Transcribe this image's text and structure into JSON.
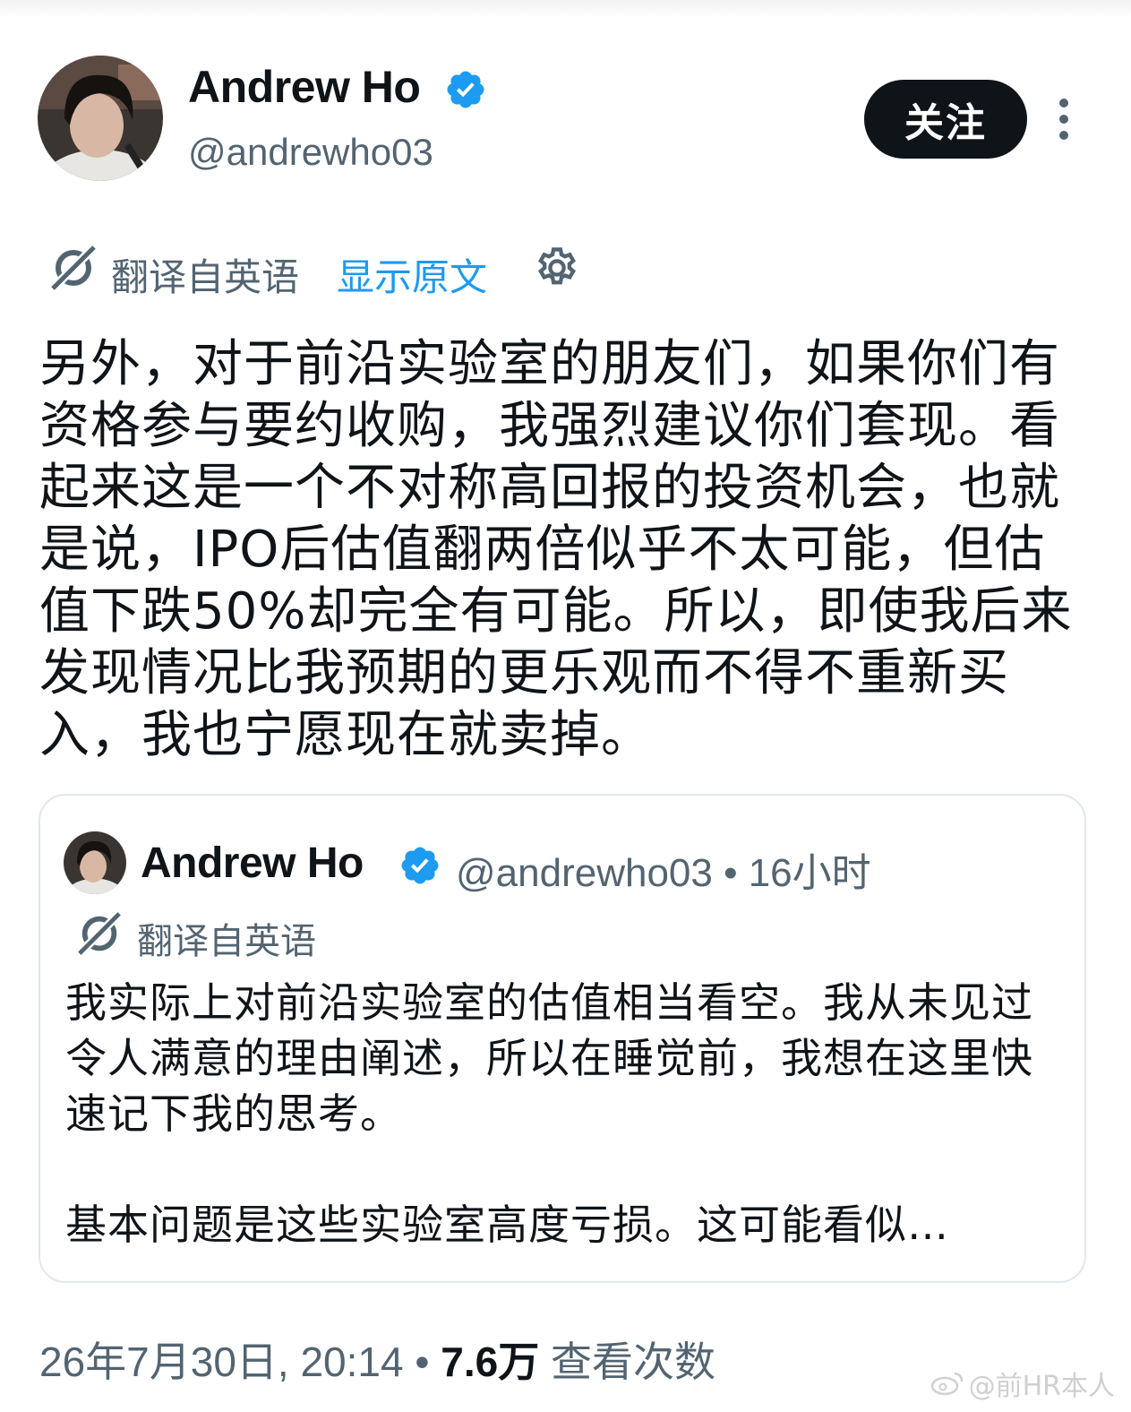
{
  "author": {
    "name": "Andrew Ho",
    "handle": "@andrewho03"
  },
  "header": {
    "follow_label": "关注"
  },
  "translation": {
    "label": "翻译自英语",
    "show_original": "显示原文"
  },
  "post": {
    "text": "另外，对于前沿实验室的朋友们，如果你们有资格参与要约收购，我强烈建议你们套现。看起来这是一个不对称高回报的投资机会，也就是说，IPO后估值翻两倍似乎不太可能，但估值下跌50%却完全有可能。所以，即使我后来发现情况比我预期的更乐观而不得不重新买入，我也宁愿现在就卖掉。"
  },
  "quote": {
    "name": "Andrew Ho",
    "meta": "@andrewho03 • 16小时",
    "translation_label": "翻译自英语",
    "text": "我实际上对前沿实验室的估值相当看空。我从未见过令人满意的理由阐述，所以在睡觉前，我想在这里快速记下我的思考。",
    "text_more": "基本问题是这些实验室高度亏损。这可能看似…"
  },
  "footer": {
    "timestamp": "26年7月30日, 20:14 • ",
    "views_count": "7.6万",
    "views_label": " 查看次数"
  },
  "watermark": {
    "text": "@前HR本人"
  },
  "colors": {
    "accent": "#1d9bf0",
    "text_primary": "#0f1419",
    "text_secondary": "#536471",
    "button_bg": "#0f1419"
  },
  "icons": [
    "verified-badge-icon",
    "more-vertical-icon",
    "translate-icon",
    "gear-icon",
    "weibo-icon"
  ]
}
